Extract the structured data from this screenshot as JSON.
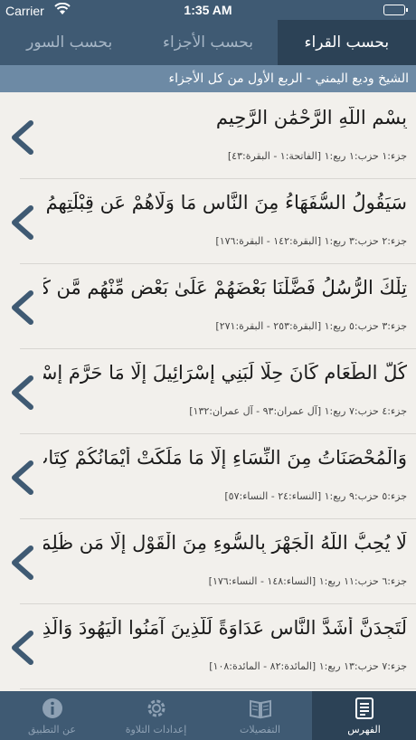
{
  "status": {
    "carrier": "Carrier",
    "time": "1:35 AM"
  },
  "top_tabs": [
    {
      "label": "بحسب السور",
      "active": false
    },
    {
      "label": "بحسب الأجزاء",
      "active": false
    },
    {
      "label": "بحسب القراء",
      "active": true
    }
  ],
  "subtitle": "الشيخ وديع اليمني - الربع الأول من كل الأجزاء",
  "rows": [
    {
      "verse": "بِسْمِ اللَّهِ الرَّحْمَٰنِ الرَّحِيمِ",
      "ref": "جزء:١ حزب:١ ربع:١  [الفاتحة:١ - البقرة:٤٣]"
    },
    {
      "verse": "سَيَقُولُ السُّفَهَاءُ مِنَ النَّاسِ مَا وَلَّاهُمْ عَن قِبْلَتِهِمُ الَّتِي كَانُوا عَلَيْهَا قُل",
      "ref": "جزء:٢ حزب:٣ ربع:١  [البقرة:١٤٢ - البقرة:١٧٦]"
    },
    {
      "verse": "تِلْكَ الرُّسُلُ فَضَّلْنَا بَعْضَهُمْ عَلَىٰ بَعْضٍ مِّنْهُم مَّن كَلَّمَ اللَّهُ وَرَفَعَ بَعْضَهُمْ",
      "ref": "جزء:٣ حزب:٥ ربع:١  [البقرة:٢٥٣ - البقرة:٢٧١]"
    },
    {
      "verse": "كُلُّ الطَّعَامِ كَانَ حِلًّا لِّبَنِي إِسْرَائِيلَ إِلَّا مَا حَرَّمَ إِسْرَائِيلُ عَلَىٰ نَفْسِهِ مِن",
      "ref": "جزء:٤ حزب:٧ ربع:١  [آل عمران:٩٣ - آل عمران:١٣٢]"
    },
    {
      "verse": "وَالْمُحْصَنَاتُ مِنَ النِّسَاءِ إِلَّا مَا مَلَكَتْ أَيْمَانُكُمْ كِتَابَ اللَّهِ عَلَيْكُمْ وَأُحِلَّ",
      "ref": "جزء:٥ حزب:٩ ربع:١  [النساء:٢٤ - النساء:٥٧]"
    },
    {
      "verse": "لَّا يُحِبُّ اللَّهُ الْجَهْرَ بِالسُّوءِ مِنَ الْقَوْلِ إِلَّا مَن ظُلِمَ وَكَانَ اللَّهُ سَمِيعًا عَلِيمًا",
      "ref": "جزء:٦ حزب:١١ ربع:١  [النساء:١٤٨ - النساء:١٧٦]"
    },
    {
      "verse": "لَتَجِدَنَّ أَشَدَّ النَّاسِ عَدَاوَةً لِّلَّذِينَ آمَنُوا الْيَهُودَ وَالَّذِينَ أَشْرَكُوا وَلَتَجِدَنَّ",
      "ref": "جزء:٧ حزب:١٣ ربع:١  [المائدة:٨٢ - المائدة:١٠٨]"
    }
  ],
  "tabbar": [
    {
      "label": "عن التطبيق",
      "icon": "info-icon",
      "active": false
    },
    {
      "label": "إعدادات التلاوة",
      "icon": "gear-icon",
      "active": false
    },
    {
      "label": "التفصيلات",
      "icon": "book-icon",
      "active": false
    },
    {
      "label": "الفهرس",
      "icon": "index-icon",
      "active": true
    }
  ],
  "colors": {
    "header": "#3f5a73",
    "active_tab": "#2c4256",
    "subtitle_bar": "#6d8aa5",
    "chevron": "#3f5a73"
  }
}
